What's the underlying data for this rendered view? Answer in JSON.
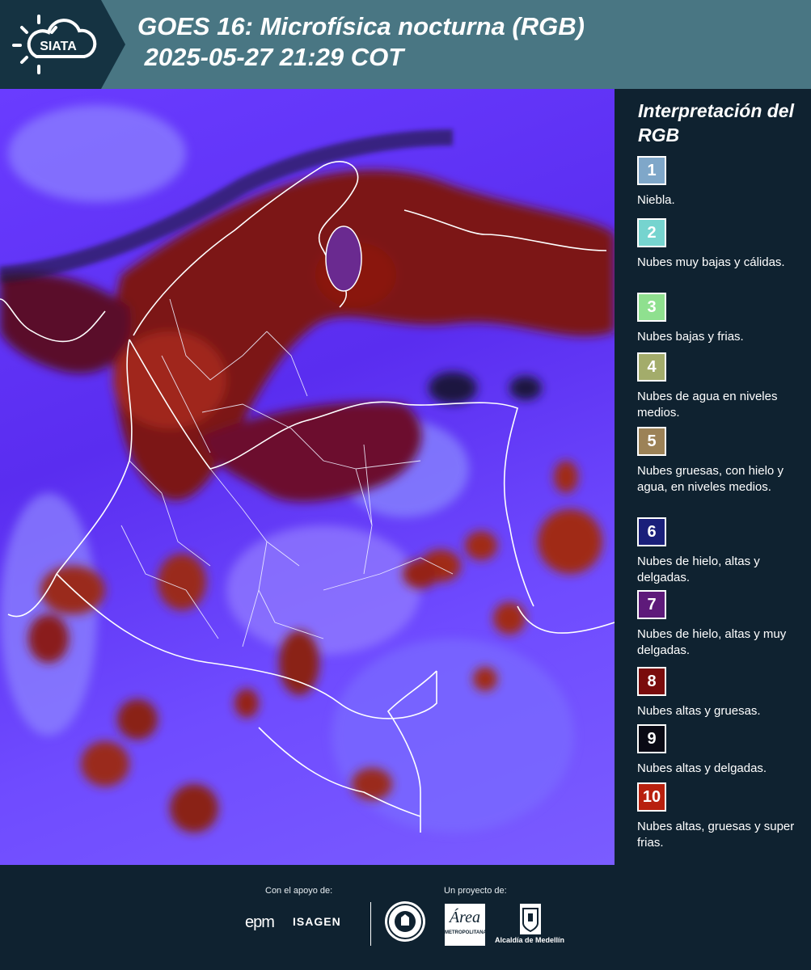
{
  "header": {
    "logo_text": "SIATA",
    "title_line1": "GOES 16: Microfísica nocturna (RGB)",
    "title_line2": " 2025-05-27 21:29 COT",
    "background_color": "#497683"
  },
  "legend": {
    "title": "Interpretación del RGB",
    "items": [
      {
        "number": "1",
        "label": "Niebla.",
        "color": "#7fa7c9"
      },
      {
        "number": "2",
        "label": "Nubes muy bajas y cálidas.",
        "color": "#76d4cf"
      },
      {
        "number": "3",
        "label": "Nubes bajas y frias.",
        "color": "#8fe08f"
      },
      {
        "number": "4",
        "label": "Nubes de agua en niveles medios.",
        "color": "#a3ac6b"
      },
      {
        "number": "5",
        "label": "Nubes gruesas, con hielo y agua, en niveles medios.",
        "color": "#9c8257"
      },
      {
        "number": "6",
        "label": "Nubes de hielo, altas y delgadas.",
        "color": "#1a1f7a"
      },
      {
        "number": "7",
        "label": "Nubes de hielo, altas y muy delgadas.",
        "color": "#5e1a7a"
      },
      {
        "number": "8",
        "label": "Nubes altas y gruesas.",
        "color": "#7a0c0c"
      },
      {
        "number": "9",
        "label": "Nubes altas y delgadas.",
        "color": "#0a0a14"
      },
      {
        "number": "10",
        "label": "Nubes altas, gruesas y super frias.",
        "color": "#b8200e"
      }
    ]
  },
  "footer": {
    "support_label": "Con el apoyo de:",
    "project_label": "Un proyecto de:",
    "sponsor_1": "epm",
    "sponsor_2": "ISAGEN",
    "partner_label": "Alcaldía de Medellín",
    "area_logo_text": "Área",
    "area_logo_sub": "METROPOLITANA"
  }
}
